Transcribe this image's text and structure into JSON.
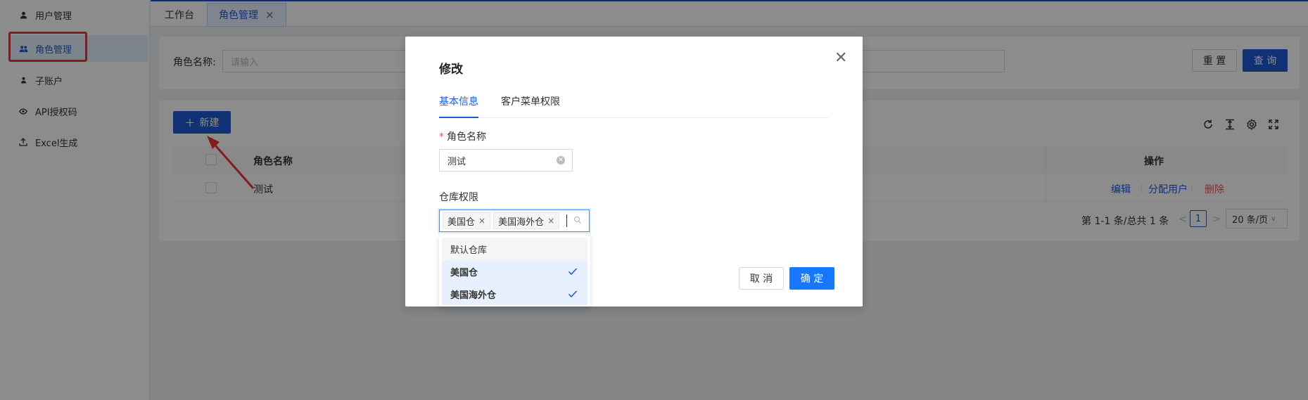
{
  "sidebar": {
    "items": [
      {
        "label": "用户管理",
        "icon": "user-icon"
      },
      {
        "label": "角色管理",
        "icon": "team-icon"
      },
      {
        "label": "子账户",
        "icon": "user-small-icon"
      },
      {
        "label": "API授权码",
        "icon": "eye-icon"
      },
      {
        "label": "Excel生成",
        "icon": "upload-icon"
      }
    ],
    "active_index": 1
  },
  "tabs": [
    {
      "label": "工作台"
    },
    {
      "label": "角色管理",
      "closable": true,
      "close_glyph": "×"
    }
  ],
  "search": {
    "label": "角色名称:",
    "placeholder": "请输入",
    "reset_label": "重 置",
    "query_label": "查 询"
  },
  "toolbar": {
    "new_label": "新建",
    "new_glyph": "＋",
    "icons": [
      "reload-icon",
      "column-height-icon",
      "setting-icon",
      "fullscreen-icon"
    ]
  },
  "table": {
    "columns": [
      "角色名称",
      "操作"
    ],
    "rows": [
      {
        "name": "测试",
        "actions": [
          "编辑",
          "分配用户",
          "删除"
        ]
      }
    ]
  },
  "pagination": {
    "summary": "第 1-1 条/总共 1 条",
    "prev": "<",
    "current": "1",
    "next": ">",
    "page_size": "20 条/页",
    "page_size_caret": "∨"
  },
  "modal": {
    "title": "修改",
    "close_glyph": "✕",
    "tabs": [
      "基本信息",
      "客户菜单权限"
    ],
    "active_tab": 0,
    "required_mark": "*",
    "role_name_label": "角色名称",
    "role_name_value": "测试",
    "warehouse_label": "仓库权限",
    "selected_tags": [
      "美国仓",
      "美国海外仓"
    ],
    "tag_remove_glyph": "×",
    "options": [
      {
        "label": "默认仓库",
        "selected": false
      },
      {
        "label": "美国仓",
        "selected": true
      },
      {
        "label": "美国海外仓",
        "selected": true
      }
    ],
    "cancel_label": "取 消",
    "ok_label": "确 定"
  },
  "colors": {
    "primary": "#1e5bd6",
    "danger": "#ff4d4f",
    "highlight_box": "#ee3333"
  }
}
